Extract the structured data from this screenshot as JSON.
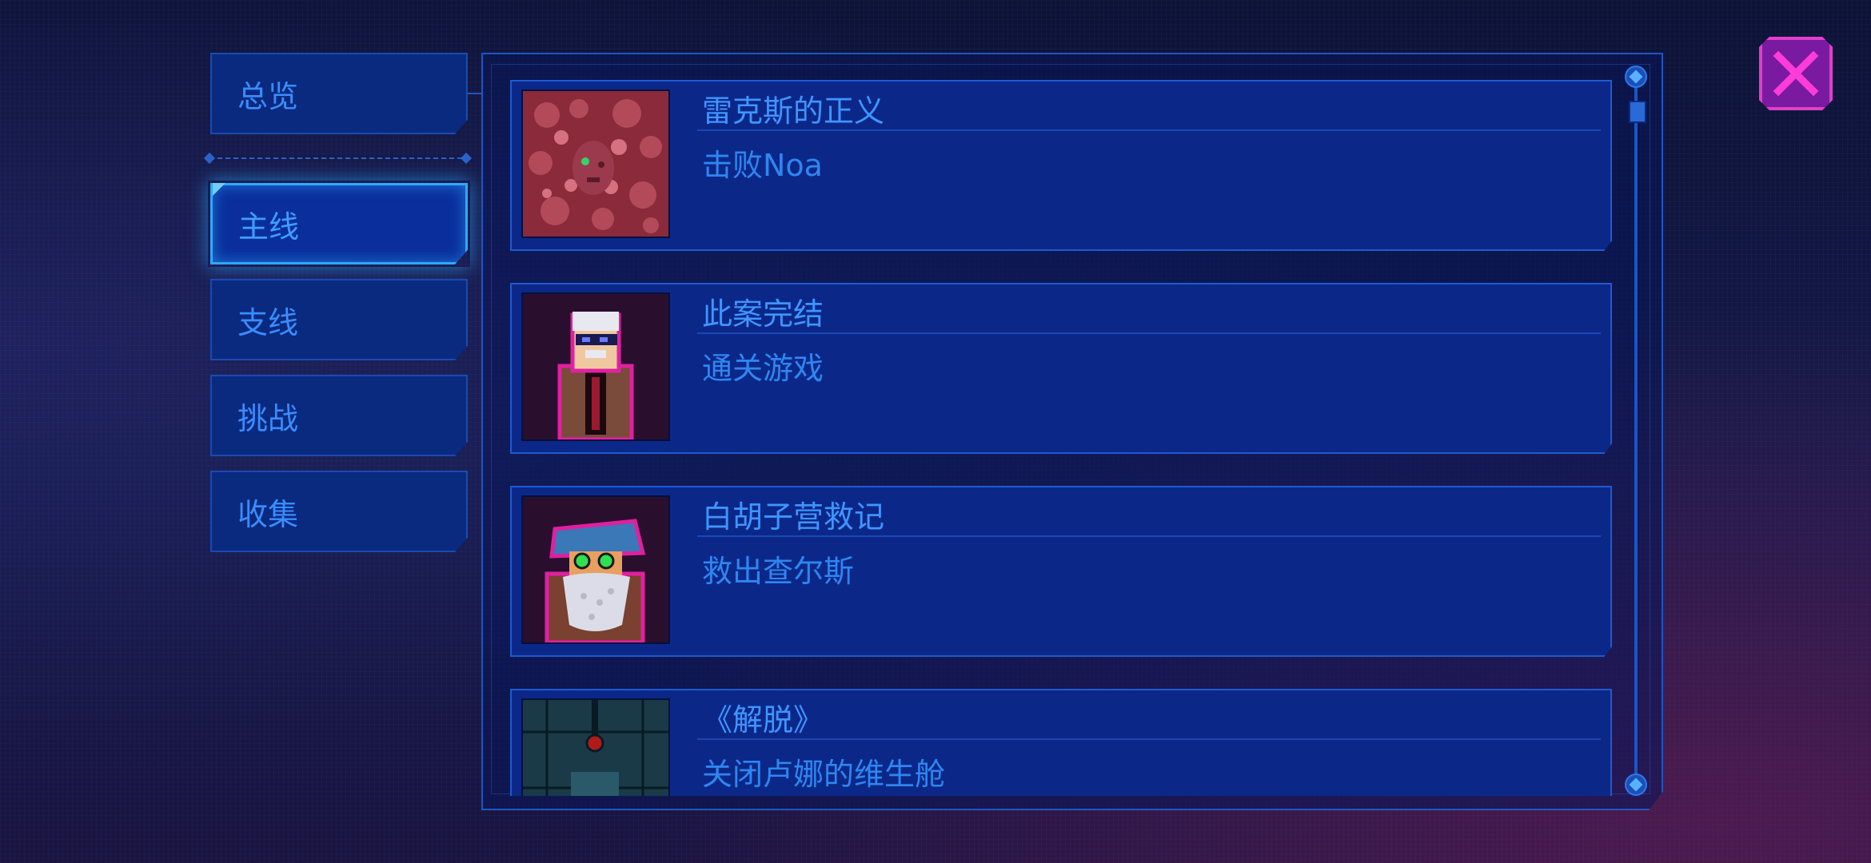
{
  "nav": {
    "items": [
      {
        "id": "overview",
        "label": "总览"
      },
      {
        "id": "main",
        "label": "主线",
        "active": true
      },
      {
        "id": "side",
        "label": "支线"
      },
      {
        "id": "challenge",
        "label": "挑战"
      },
      {
        "id": "collect",
        "label": "收集"
      }
    ]
  },
  "achievements": [
    {
      "title": "雷克斯的正义",
      "desc": "击败Noa",
      "icon": "noa-flesh-portrait-icon"
    },
    {
      "title": "此案完结",
      "desc": "通关游戏",
      "icon": "detective-portrait-icon"
    },
    {
      "title": "白胡子营救记",
      "desc": "救出查尔斯",
      "icon": "bearded-old-man-portrait-icon"
    },
    {
      "title": "《解脱》",
      "desc": "关闭卢娜的维生舱",
      "icon": "life-pod-icon"
    }
  ],
  "colors": {
    "accent": "#2fa8ff",
    "text": "#3f95ff",
    "close": "#e040c8"
  }
}
